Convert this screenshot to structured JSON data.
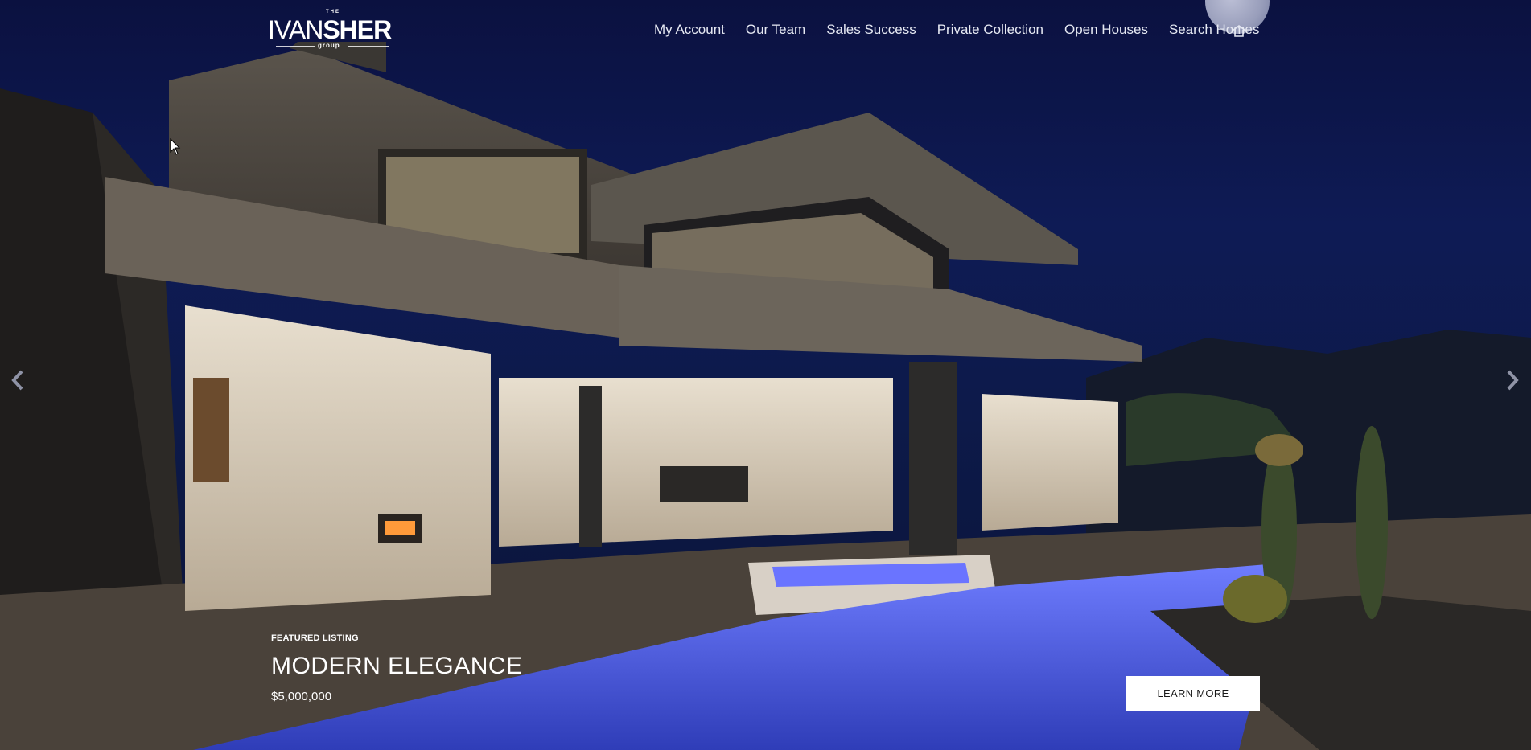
{
  "logo": {
    "the": "THE",
    "ivan": "IVAN",
    "sher": "SHER",
    "group": "group"
  },
  "nav": {
    "items": [
      {
        "label": "My Account"
      },
      {
        "label": "Our Team"
      },
      {
        "label": "Sales Success"
      },
      {
        "label": "Private Collection"
      },
      {
        "label": "Open Houses"
      },
      {
        "label": "Search Homes"
      }
    ],
    "search_icon": "home-icon"
  },
  "slider": {
    "prev_icon": "chevron-left-icon",
    "next_icon": "chevron-right-icon"
  },
  "featured": {
    "tag": "FEATURED LISTING",
    "title": "MODERN ELEGANCE",
    "price": "$5,000,000",
    "button_label": "LEARN MORE"
  },
  "colors": {
    "nav_text": "#e6e9f3",
    "sky": "#0e1b55",
    "pool": "#3e4cff"
  }
}
